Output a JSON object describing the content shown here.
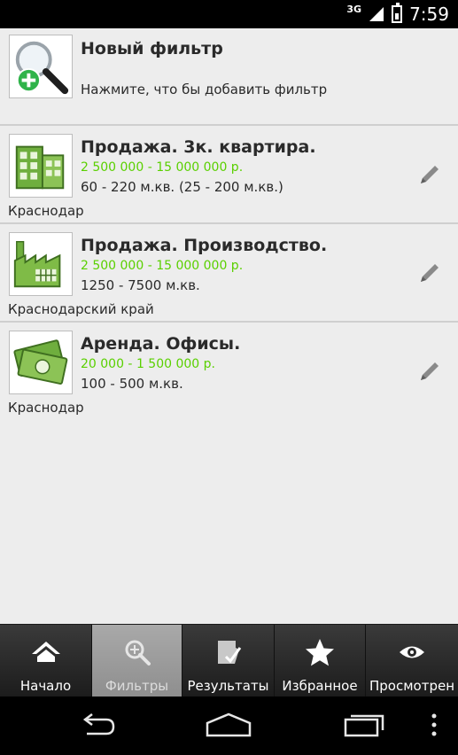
{
  "status": {
    "network": "3G",
    "time": "7:59"
  },
  "new_filter": {
    "title": "Новый фильтр",
    "subtitle": "Нажмите, что бы добавить фильтр"
  },
  "filters": [
    {
      "title": "Продажа. 3к. квартира.",
      "price": "2 500 000 - 15 000 000 р.",
      "area": "60 - 220 м.кв. (25 - 200 м.кв.)",
      "location": "Краснодар",
      "icon": "apartment-building-icon"
    },
    {
      "title": "Продажа. Производство.",
      "price": "2 500 000 - 15 000 000 р.",
      "area": "1250 - 7500 м.кв.",
      "location": "Краснодарский край",
      "icon": "factory-icon"
    },
    {
      "title": "Аренда. Офисы.",
      "price": "20 000 - 1 500 000 р.",
      "area": "100 - 500 м.кв.",
      "location": "Краснодар",
      "icon": "money-icon"
    }
  ],
  "tabs": [
    {
      "label": "Начало",
      "icon": "home-icon",
      "active": false
    },
    {
      "label": "Фильтры",
      "icon": "search-icon",
      "active": true
    },
    {
      "label": "Результаты",
      "icon": "results-icon",
      "active": false
    },
    {
      "label": "Избранное",
      "icon": "star-icon",
      "active": false
    },
    {
      "label": "Просмотрен",
      "icon": "eye-icon",
      "active": false
    }
  ],
  "colors": {
    "price": "#5ad000",
    "active_tab": "#9a9a9a",
    "background": "#ededed"
  }
}
